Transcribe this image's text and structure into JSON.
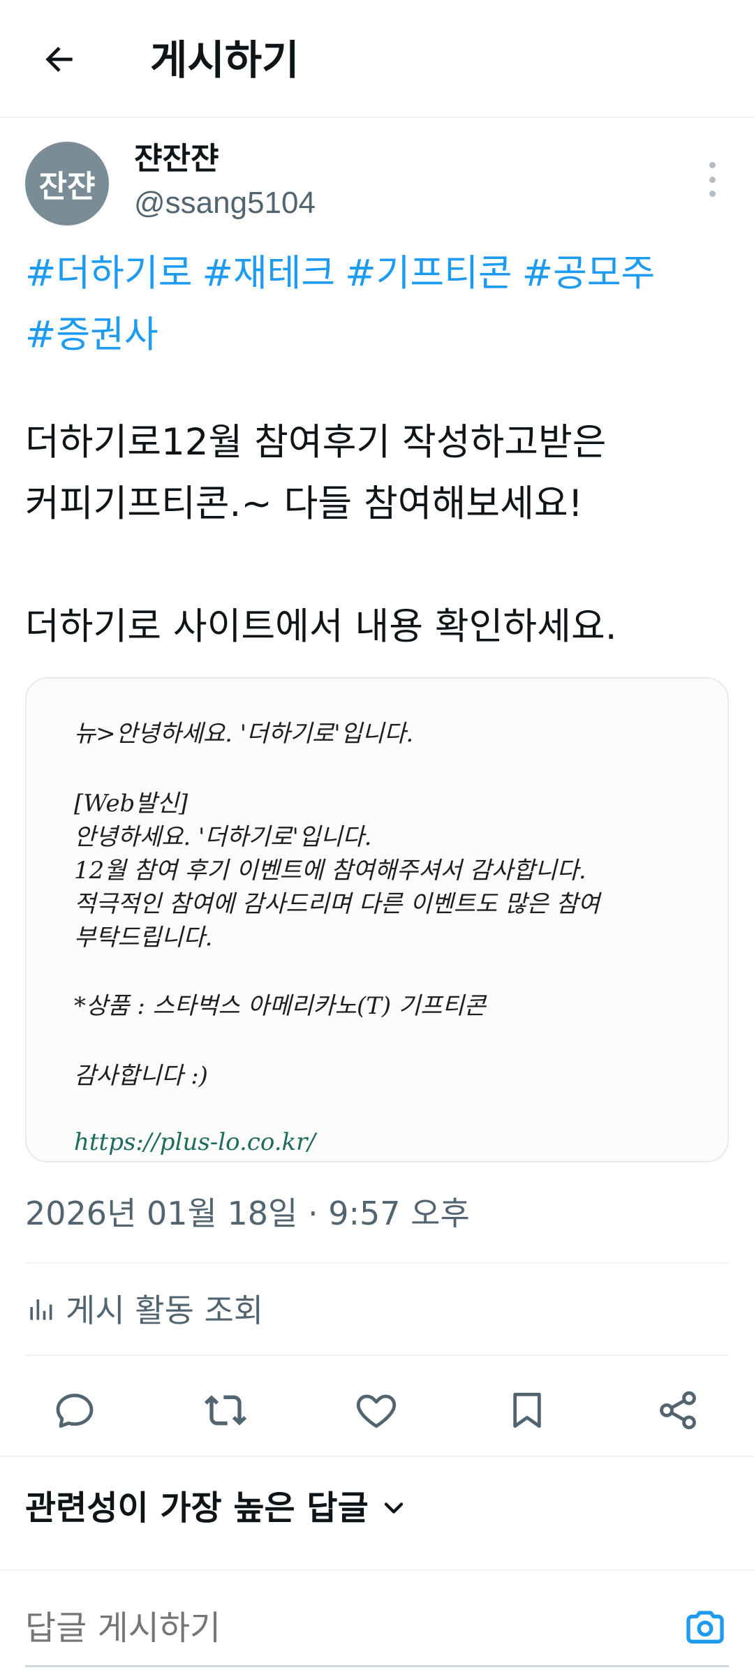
{
  "header": {
    "title": "게시하기"
  },
  "author": {
    "avatar_text": "잔쟌",
    "name": "쟌잔쟌",
    "handle": "@ssang5104"
  },
  "post": {
    "hashtags": [
      "#더하기로",
      "#재테크",
      "#기프티콘",
      "#공모주",
      "#증권사"
    ],
    "body": "더하기로12월 참여후기 작성하고받은\n커피기프티콘.~ 다들 참여해보세요!\n\n더하기로 사이트에서 내용 확인하세요.",
    "image_text": [
      "뉴>안녕하세요. '더하기로'입니다.",
      "[Web발신]",
      "안녕하세요. '더하기로'입니다.",
      "12월 참여 후기 이벤트에 참여해주셔서 감사합니다.",
      "적극적인 참여에 감사드리며 다른 이벤트도 많은 참여",
      "부탁드립니다.",
      "*상품 : 스타벅스 아메리카노(T) 기프티콘",
      "감사합니다 :)",
      "https://plus-lo.co.kr/"
    ],
    "timestamp": "2026년 01월 18일 · 9:57 오후",
    "activity_label": "게시 활동 조회"
  },
  "actions": {
    "icons": [
      "reply-icon",
      "repost-icon",
      "like-icon",
      "bookmark-icon",
      "share-icon"
    ]
  },
  "replies": {
    "sort_label": "관련성이 가장 높은 답글"
  },
  "composer": {
    "placeholder": "답글 게시하기"
  },
  "colors": {
    "accent": "#1d9bf0",
    "secondary_text": "#536471",
    "text": "#0f1419"
  }
}
